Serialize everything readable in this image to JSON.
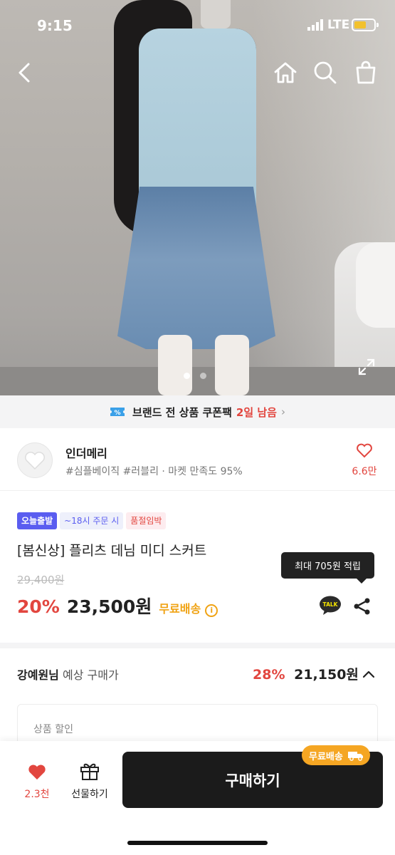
{
  "status": {
    "time": "9:15",
    "network": "LTE"
  },
  "nav": {
    "back_icon": "back-arrow-icon",
    "home_icon": "home-icon",
    "search_icon": "search-icon",
    "bag_icon": "shopping-bag-icon"
  },
  "gallery": {
    "current": 1,
    "total": 2
  },
  "coupon": {
    "text": "브랜드 전 상품 쿠폰팩",
    "remaining": "2일 남음",
    "chevron": "›"
  },
  "brand": {
    "name": "인더메리",
    "meta": "#심플베이직 #러블리 · 마켓 만족도 95%",
    "likes": "6.6만"
  },
  "product": {
    "badges": [
      "오늘출발",
      "~18시 주문 시",
      "품절임박"
    ],
    "title": "[봄신상] 플리츠 데님 미디 스커트",
    "original_price": "29,400원",
    "discount": "20%",
    "price": "23,500원",
    "shipping": "무료배송",
    "tooltip": "최대 705원 적립",
    "talk_label": "TALK"
  },
  "expected": {
    "user": "강예원님",
    "label": "예상 구매가",
    "percent": "28%",
    "amount": "21,150원"
  },
  "discount_card": {
    "label": "상품 할인"
  },
  "bottom": {
    "likes": "2.3천",
    "gift": "선물하기",
    "buy": "구매하기",
    "free_tag": "무료배송"
  },
  "colors": {
    "accent_red": "#e2463f",
    "shipping_orange": "#f0a314",
    "badge_purple": "#5a5df0",
    "buy_black": "#1b1b1b"
  }
}
